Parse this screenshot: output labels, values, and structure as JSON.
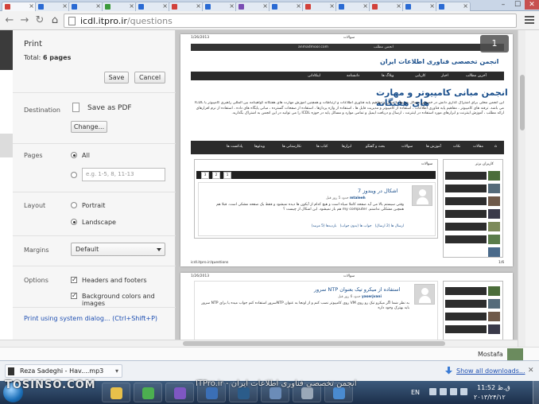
{
  "tabs": [
    {
      "color": "#d2413a"
    },
    {
      "color": "#2a6ad3"
    },
    {
      "color": "#2a6ad3"
    },
    {
      "color": "#3c9a3c"
    },
    {
      "color": "#2a6ad3"
    },
    {
      "color": "#d2413a"
    },
    {
      "color": "#2a6ad3"
    },
    {
      "color": "#7a4db3"
    },
    {
      "color": "#2a6ad3"
    },
    {
      "color": "#d2413a"
    },
    {
      "color": "#2a6ad3"
    },
    {
      "color": "#d2413a"
    },
    {
      "color": "#2a6ad3"
    },
    {
      "color": "#2a6ad3"
    }
  ],
  "toolbar": {
    "url_host": "icdl.itpro.ir",
    "url_path": "/questions"
  },
  "print": {
    "title": "Print",
    "total_label": "Total:",
    "total_value": "6 pages",
    "save_label": "Save",
    "cancel_label": "Cancel",
    "destination_label": "Destination",
    "destination_value": "Save as PDF",
    "change_label": "Change...",
    "pages_label": "Pages",
    "pages_all": "All",
    "pages_range_placeholder": "e.g. 1-5, 8, 11-13",
    "layout_label": "Layout",
    "layout_portrait": "Portrait",
    "layout_landscape": "Landscape",
    "margins_label": "Margins",
    "margins_value": "Default",
    "options_label": "Options",
    "option_headers": "Headers and footers",
    "option_background": "Background colors and images",
    "system_dialog_link": "Print using system dialog... (Ctrl+Shift+P)"
  },
  "preview": {
    "page_badge": "1",
    "page1": {
      "header_left": "1/26/2013",
      "header_center": "سوالات",
      "topbar_user": "anmadmoor.com",
      "topbar_menu": "انجمن مطلب",
      "site_title": "انجمن تخصصی فناوری اطلاعات ایران",
      "top_menu": [
        "آخرین مطالب",
        "اخبار",
        "کاریابی",
        "وبلاگ ها",
        "دانشنامه",
        "اینکادانی"
      ],
      "heading": "انجمن مبانی کامپیوتر و مهارت های هفتگانه",
      "intro": "این انجمن محلی برای اشتراک گذاری دانش در خصوص مسائل مرتبط با مبانی و مفاهیم پایه فناوری اطلاعات و ارتباطات و همچنین آموزش مهارت های هفتگانه کواهینامه بین المللی راهبری کامپیوتر یا ICDL می باشد. ترفند های کامپیوتر ، مفاهیم پایه فناوری اطلاعات ، استفاده از کامپیوتر و مدیریت فایل ها ، استفاده از واژه پردازها ، استفاده از صفحات گسترده ، مبانی پایگاه های داده ، استفاده از نرم افزارهای ارائه مطلب ، آموزش اینترنت و ابزارهای مورد استفاده در اینترنت ، ارسال و دریافت ایمیل و تمامی موارد و مسائل پایه در حوزه ICDL را می توانید در این انجمن به اشتراک بگذارید.",
      "nav": [
        "مقالات",
        "نکات",
        "آموزش ها",
        "سوالات",
        "بحث و گفتگو",
        "ابزارها",
        "کتاب ها",
        "نکارستانی ها",
        "ویدئوها",
        "پادکست ها"
      ],
      "questions_title": "سوالات",
      "users_title": "کاربران برتر",
      "pager": [
        "3",
        "2",
        "1"
      ],
      "question": {
        "title": "اشکال در ویندوز 7",
        "meta_author": "mtaleeh",
        "meta_time": "حدود 5 روز قبل",
        "body": "وقتی سیستم بالا می آید صفحه کاملا سیاه است و هیچ کدام از آیکون ها دیده نمیشود و فقط یک صفحه مشکی است. قبلا هم همچین مشکلی نداشتم. my computer هم باز نمیشود. این اشکال از چیست ؟",
        "links": [
          "ارسال ها (2 ارسال)",
          "جواب ها (بدون جواب)",
          "بازدیدها (5 مرتبه)"
        ]
      },
      "footer_left": "icdl.itpro.ir/questions",
      "footer_right": "1/6"
    },
    "page2": {
      "header_left": "1/26/2013",
      "header_center": "سوالات",
      "question_title": "استفاده از میکرو تیک بعنوان NTP سرور",
      "meta_author": "yaserjvani",
      "meta_time": "حدود 6 روز قبل",
      "body": "به نظر شما اگر میکرو تیک رو روی VM روی کامپیوتر نصب کنم و از اونجا به عنوان NTPسرور استفاده کنم جواب میده یا برای NTP سرور باید بهترک وجود داره"
    }
  },
  "behind": {
    "name": "Mostafa"
  },
  "download": {
    "file_name": "Reza Sadeghi - Hav....mp3",
    "show_all": "Show all downloads..."
  },
  "taskbar": {
    "watermark_left": "TOSINSO.COM",
    "watermark_right": "انجمن تخصصی فناوری اطلاعات ایران - ITPro.ir",
    "lang": "EN",
    "time": "11:52 ق.ظ",
    "date": "۲۰۱۳/۲۴/۱۲",
    "apps": [
      {
        "name": "folder",
        "color": "#e8c04a"
      },
      {
        "name": "chrome",
        "color": "#4caf50"
      },
      {
        "name": "visual-studio",
        "color": "#7e57c2"
      },
      {
        "name": "player",
        "color": "#3b6fb6"
      },
      {
        "name": "photoshop",
        "color": "#2b5c8a"
      },
      {
        "name": "terminal",
        "color": "#6b8cb8"
      },
      {
        "name": "network",
        "color": "#9aa8b8"
      },
      {
        "name": "mail",
        "color": "#4a8bd0"
      }
    ]
  }
}
